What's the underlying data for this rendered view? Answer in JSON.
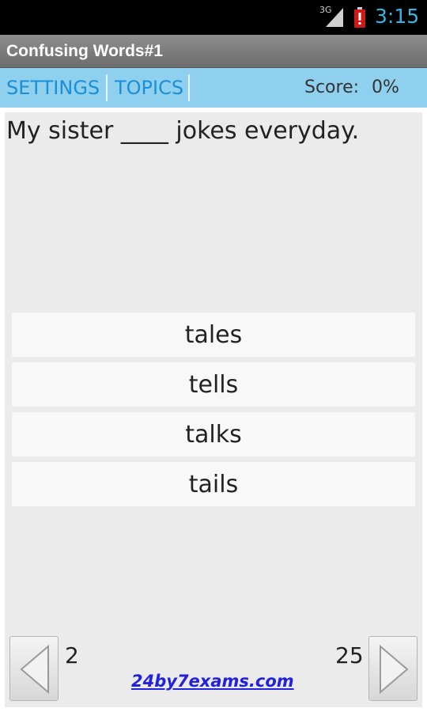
{
  "status_bar": {
    "network_label": "3G",
    "time": "3:15",
    "accent_color": "#33b5e5",
    "icons": [
      "signal-icon",
      "battery-alert-icon"
    ]
  },
  "app": {
    "title": "Confusing Words#1"
  },
  "menu": {
    "settings_label": "SETTINGS",
    "topics_label": "TOPICS",
    "score_label": "Score:",
    "score_value": "0%",
    "background_color": "#8fd0ee",
    "link_color": "#1a8fd8"
  },
  "quiz": {
    "question": "My sister ____ jokes everyday.",
    "answers": [
      "tales",
      "tells",
      "talks",
      "tails"
    ]
  },
  "navigation": {
    "current_page": "2",
    "total_pages": "25",
    "prev_icon": "arrow-left-icon",
    "next_icon": "arrow-right-icon"
  },
  "footer": {
    "link_text": "24by7exams.com",
    "link_color": "#2222dd"
  }
}
